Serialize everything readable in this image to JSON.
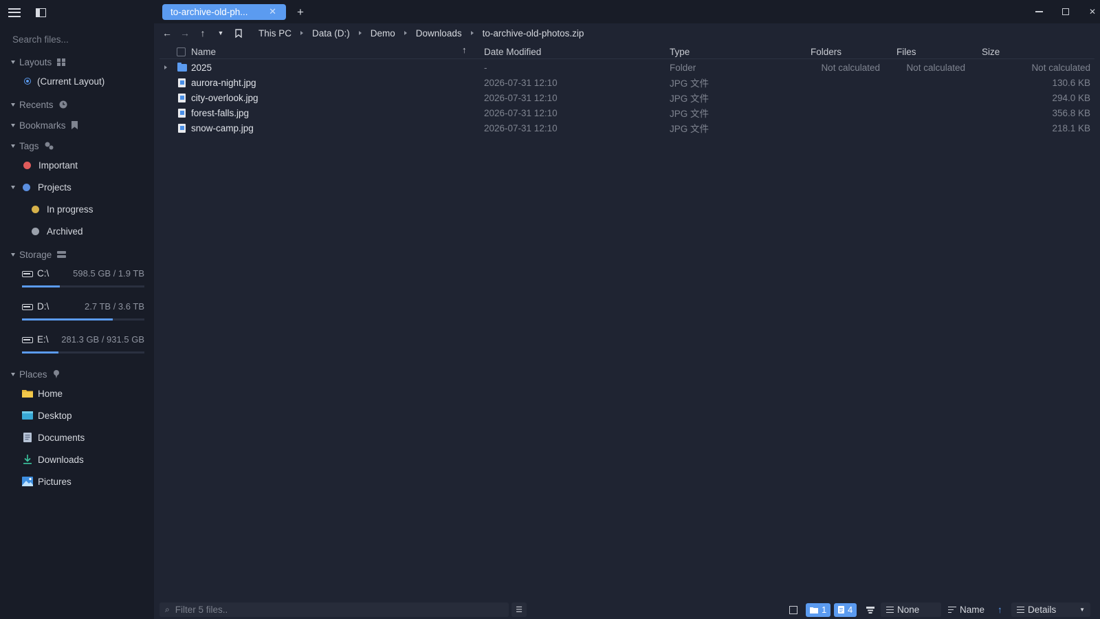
{
  "sidebar": {
    "search_placeholder": "Search files...",
    "sections": {
      "layouts": "Layouts",
      "recents": "Recents",
      "bookmarks": "Bookmarks",
      "tags": "Tags",
      "storage": "Storage",
      "places": "Places"
    },
    "current_layout": "(Current Layout)",
    "tags": [
      {
        "label": "Important",
        "color": "#e05b5b"
      },
      {
        "label": "Projects",
        "color": "#5b8fe0"
      },
      {
        "label": "In progress",
        "color": "#d6b14a"
      },
      {
        "label": "Archived",
        "color": "#9aa0ab"
      }
    ],
    "drives": [
      {
        "name": "C:\\",
        "size": "598.5 GB / 1.9 TB",
        "usage": 0.31
      },
      {
        "name": "D:\\",
        "size": "2.7 TB / 3.6 TB",
        "usage": 0.74
      },
      {
        "name": "E:\\",
        "size": "281.3 GB / 931.5 GB",
        "usage": 0.3
      }
    ],
    "places": [
      "Home",
      "Desktop",
      "Documents",
      "Downloads",
      "Pictures"
    ]
  },
  "tabs": [
    {
      "label": "to-archive-old-ph..."
    }
  ],
  "breadcrumb": [
    "This PC",
    "Data (D:)",
    "Demo",
    "Downloads",
    "to-archive-old-photos.zip"
  ],
  "columns": {
    "name": "Name",
    "date": "Date Modified",
    "type": "Type",
    "folders": "Folders",
    "files": "Files",
    "size": "Size"
  },
  "rows": [
    {
      "name": "2025",
      "date": "-",
      "type": "Folder",
      "folders": "Not calculated",
      "files": "Not calculated",
      "size": "Not calculated"
    },
    {
      "name": "aurora-night.jpg",
      "date": "2026-07-31 12:10",
      "type": "JPG 文件",
      "folders": "",
      "files": "",
      "size": "130.6 KB"
    },
    {
      "name": "city-overlook.jpg",
      "date": "2026-07-31 12:10",
      "type": "JPG 文件",
      "folders": "",
      "files": "",
      "size": "294.0 KB"
    },
    {
      "name": "forest-falls.jpg",
      "date": "2026-07-31 12:10",
      "type": "JPG 文件",
      "folders": "",
      "files": "",
      "size": "356.8 KB"
    },
    {
      "name": "snow-camp.jpg",
      "date": "2026-07-31 12:10",
      "type": "JPG 文件",
      "folders": "",
      "files": "",
      "size": "218.1 KB"
    }
  ],
  "status": {
    "filter_placeholder": "Filter 5 files..",
    "folder_count": "1",
    "file_count": "4",
    "group_by": "None",
    "sort_by": "Name",
    "view_mode": "Details"
  },
  "colors": {
    "accent": "#5b9bf0",
    "sidebar_bg": "#181c27",
    "main_bg": "#1f2432"
  }
}
